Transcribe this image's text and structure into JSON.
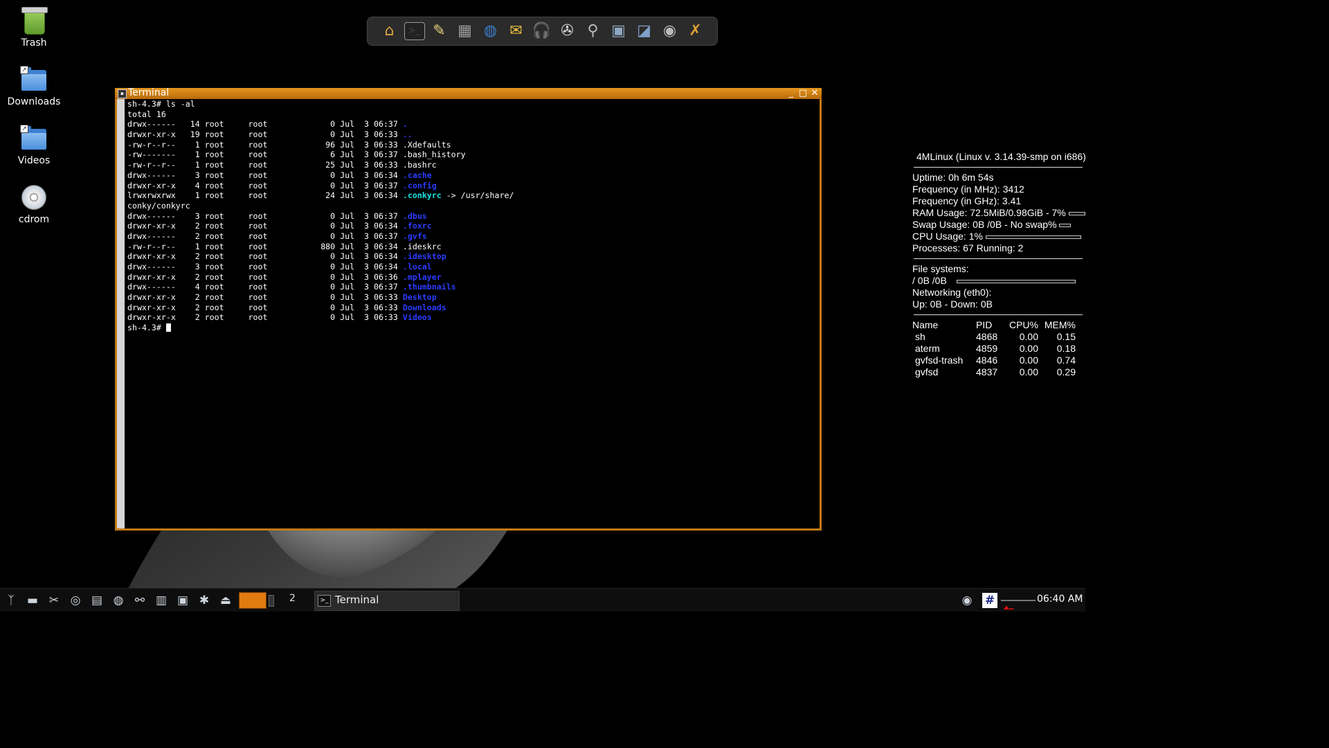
{
  "desktop_icons": [
    {
      "label": "Trash",
      "icon": "trash-icon"
    },
    {
      "label": "Downloads",
      "icon": "folder-icon"
    },
    {
      "label": "Videos",
      "icon": "folder-icon"
    },
    {
      "label": "cdrom",
      "icon": "cdrom-icon"
    }
  ],
  "dock": {
    "items": [
      {
        "name": "home-icon",
        "glyph": "⌂",
        "color": "#d9a441"
      },
      {
        "name": "terminal-icon",
        "glyph": ">_",
        "color": "#444444"
      },
      {
        "name": "text-editor-icon",
        "glyph": "✎",
        "color": "#e8d27a"
      },
      {
        "name": "calculator-icon",
        "glyph": "▦",
        "color": "#9a9a9a"
      },
      {
        "name": "browser-icon",
        "glyph": "◍",
        "color": "#3a7fd0"
      },
      {
        "name": "mail-icon",
        "glyph": "✉",
        "color": "#f0c040"
      },
      {
        "name": "audio-player-icon",
        "glyph": "🎧",
        "color": "#555555"
      },
      {
        "name": "video-player-icon",
        "glyph": "✇",
        "color": "#dddddd"
      },
      {
        "name": "search-icon",
        "glyph": "⚲",
        "color": "#bbbbbb"
      },
      {
        "name": "image-viewer-icon",
        "glyph": "▣",
        "color": "#8fa7c0"
      },
      {
        "name": "screenshot-icon",
        "glyph": "◪",
        "color": "#7fa0c8"
      },
      {
        "name": "webcam-icon",
        "glyph": "◉",
        "color": "#bbbbbb"
      },
      {
        "name": "settings-tools-icon",
        "glyph": "✗",
        "color": "#e0a030"
      }
    ]
  },
  "terminal": {
    "title": "Terminal",
    "lines": [
      {
        "text": "sh-4.3# ls -al"
      },
      {
        "text": "total 16"
      },
      {
        "text": "drwx------   14 root     root             0 Jul  3 06:37 ",
        "name": ".",
        "type": "dir"
      },
      {
        "text": "drwxr-xr-x   19 root     root             0 Jul  3 06:33 ",
        "name": "..",
        "type": "dir"
      },
      {
        "text": "-rw-r--r--    1 root     root            96 Jul  3 06:33 .Xdefaults"
      },
      {
        "text": "-rw-------    1 root     root             6 Jul  3 06:37 .bash_history"
      },
      {
        "text": "-rw-r--r--    1 root     root            25 Jul  3 06:33 .bashrc"
      },
      {
        "text": "drwx------    3 root     root             0 Jul  3 06:34 ",
        "name": ".cache",
        "type": "dir"
      },
      {
        "text": "drwxr-xr-x    4 root     root             0 Jul  3 06:37 ",
        "name": ".config",
        "type": "dir"
      },
      {
        "text": "lrwxrwxrwx    1 root     root            24 Jul  3 06:34 ",
        "name": ".conkyrc",
        "type": "link",
        "suffix": " -> /usr/share/"
      },
      {
        "text": "conky/conkyrc"
      },
      {
        "text": "drwx------    3 root     root             0 Jul  3 06:37 ",
        "name": ".dbus",
        "type": "dir"
      },
      {
        "text": "drwxr-xr-x    2 root     root             0 Jul  3 06:34 ",
        "name": ".foxrc",
        "type": "dir"
      },
      {
        "text": "drwx------    2 root     root             0 Jul  3 06:37 ",
        "name": ".gvfs",
        "type": "dir"
      },
      {
        "text": "-rw-r--r--    1 root     root           880 Jul  3 06:34 .ideskrc"
      },
      {
        "text": "drwxr-xr-x    2 root     root             0 Jul  3 06:34 ",
        "name": ".idesktop",
        "type": "dir"
      },
      {
        "text": "drwx------    3 root     root             0 Jul  3 06:34 ",
        "name": ".local",
        "type": "dir"
      },
      {
        "text": "drwxr-xr-x    2 root     root             0 Jul  3 06:36 ",
        "name": ".mplayer",
        "type": "dir"
      },
      {
        "text": "drwx------    4 root     root             0 Jul  3 06:37 ",
        "name": ".thumbnails",
        "type": "dir"
      },
      {
        "text": "drwxr-xr-x    2 root     root             0 Jul  3 06:33 ",
        "name": "Desktop",
        "type": "dir"
      },
      {
        "text": "drwxr-xr-x    2 root     root             0 Jul  3 06:33 ",
        "name": "Downloads",
        "type": "dir"
      },
      {
        "text": "drwxr-xr-x    2 root     root             0 Jul  3 06:33 ",
        "name": "Videos",
        "type": "dir"
      }
    ],
    "prompt": "sh-4.3# "
  },
  "conky": {
    "header": "4MLinux (Linux v. 3.14.39-smp on i686)",
    "uptime": "Uptime: 0h 6m 54s",
    "freq_mhz": "Frequency (in MHz): 3412",
    "freq_ghz": "Frequency (in GHz): 3.41",
    "ram": "RAM Usage: 72.5MiB/0.98GiB - 7%",
    "ram_fraction": 0.07,
    "swap": "Swap Usage: 0B  /0B   - No swap%",
    "swap_fraction": 0,
    "cpu": "CPU Usage: 1%",
    "cpu_fraction": 0.01,
    "processes": "Processes: 67  Running: 2",
    "fs_label": "File systems:",
    "fs_root": " / 0B  /0B",
    "fs_fraction": 0,
    "net_label": "Networking (eth0):",
    "net_values": "Up: 0B    - Down: 0B",
    "proc_headers": [
      "Name",
      "PID",
      "CPU%",
      "MEM%"
    ],
    "proc_rows": [
      [
        "sh",
        "4868",
        "0.00",
        "0.15"
      ],
      [
        "aterm",
        "4859",
        "0.00",
        "0.18"
      ],
      [
        "gvfsd-trash",
        "4846",
        "0.00",
        "0.74"
      ],
      [
        "gvfsd",
        "4837",
        "0.00",
        "0.29"
      ]
    ]
  },
  "taskbar": {
    "launchers": [
      {
        "name": "menu-icon",
        "glyph": "ᛉ"
      },
      {
        "name": "show-desktop-icon",
        "glyph": "▬"
      },
      {
        "name": "tools-icon",
        "glyph": "✂"
      },
      {
        "name": "disk-icon",
        "glyph": "◎"
      },
      {
        "name": "keyboard-icon",
        "glyph": "▤"
      },
      {
        "name": "network-icon",
        "glyph": "◍"
      },
      {
        "name": "usb-icon",
        "glyph": "⚯"
      },
      {
        "name": "storage-icon",
        "glyph": "▥"
      },
      {
        "name": "image-icon",
        "glyph": "▣"
      },
      {
        "name": "bluetooth-icon",
        "glyph": "✱"
      },
      {
        "name": "eject-icon",
        "glyph": "⏏"
      }
    ],
    "desktop_number": "2",
    "task_label": "Terminal",
    "clock": "06:40 AM"
  }
}
